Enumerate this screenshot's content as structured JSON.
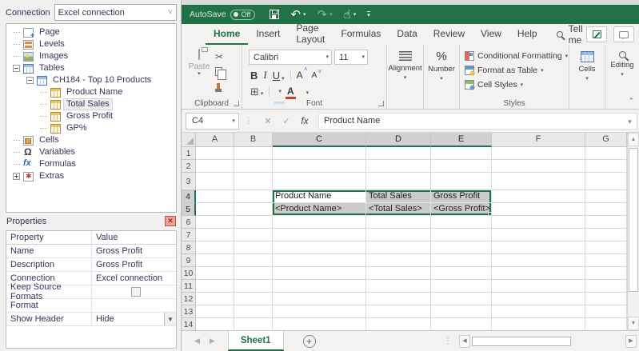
{
  "colors": {
    "excel_green": "#217346",
    "selection_fill": "#cbcbcb",
    "close_button_red": "#c0504d",
    "ribbon_bg": "#f3f2f1"
  },
  "left_panel": {
    "connection_label": "Connection",
    "connection_value": "Excel connection",
    "tree": [
      {
        "label": "Page",
        "icon": "page-icon",
        "level": 0
      },
      {
        "label": "Levels",
        "icon": "levels-icon",
        "level": 0
      },
      {
        "label": "Images",
        "icon": "images-icon",
        "level": 0
      },
      {
        "label": "Tables",
        "icon": "table-icon",
        "level": 0,
        "expander": "minus"
      },
      {
        "label": "CH184 - Top 10 Products",
        "icon": "table-icon",
        "level": 1,
        "expander": "minus"
      },
      {
        "label": "Product Name",
        "icon": "column-icon",
        "level": 2
      },
      {
        "label": "Total Sales",
        "icon": "column-icon",
        "level": 2,
        "selected": true
      },
      {
        "label": "Gross Profit",
        "icon": "column-icon",
        "level": 2
      },
      {
        "label": "GP%",
        "icon": "column-icon",
        "level": 2
      },
      {
        "label": "Cells",
        "icon": "cells-icon",
        "level": 0
      },
      {
        "label": "Variables",
        "icon": "omega-icon",
        "level": 0
      },
      {
        "label": "Formulas",
        "icon": "fx-icon",
        "level": 0
      },
      {
        "label": "Extras",
        "icon": "extras-icon",
        "level": 0,
        "expander": "plus"
      }
    ],
    "properties": {
      "title": "Properties",
      "columns": [
        "Property",
        "Value"
      ],
      "rows": [
        {
          "property": "Name",
          "value": "Gross Profit",
          "type": "text"
        },
        {
          "property": "Description",
          "value": "Gross Profit",
          "type": "text"
        },
        {
          "property": "Connection",
          "value": "Excel connection",
          "type": "text"
        },
        {
          "property": "Keep Source Formats",
          "value": "",
          "type": "checkbox",
          "checked": false
        },
        {
          "property": "Format",
          "value": "",
          "type": "text"
        },
        {
          "property": "Show Header",
          "value": "Hide",
          "type": "dropdown"
        }
      ]
    }
  },
  "excel": {
    "titlebar": {
      "autosave_label": "AutoSave",
      "autosave_state": "Off"
    },
    "tabs": [
      "Home",
      "Insert",
      "Page Layout",
      "Formulas",
      "Data",
      "Review",
      "View",
      "Help"
    ],
    "active_tab": "Home",
    "tell_me": "Tell me",
    "ribbon": {
      "paste_label": "Paste",
      "clipboard_group": "Clipboard",
      "font_name": "Calibri",
      "font_size": "11",
      "bold_label": "B",
      "italic_label": "I",
      "underline_label": "U",
      "grow_font_label": "A",
      "shrink_font_label": "A",
      "font_color_label": "A",
      "font_group": "Font",
      "alignment_group": "Alignment",
      "percent_label": "%",
      "number_group": "Number",
      "styles": [
        {
          "label": "Conditional Formatting",
          "icon": "conditional-formatting-icon"
        },
        {
          "label": "Format as Table",
          "icon": "format-as-table-icon"
        },
        {
          "label": "Cell Styles",
          "icon": "cell-styles-icon"
        }
      ],
      "styles_group": "Styles",
      "cells_group": "Cells",
      "editing_group": "Editing"
    },
    "formula_bar": {
      "name_box": "C4",
      "fx_label": "fx",
      "cancel_label": "✕",
      "enter_label": "✓",
      "content": "Product Name"
    },
    "grid": {
      "columns": [
        "A",
        "B",
        "C",
        "D",
        "E",
        "F",
        "G"
      ],
      "row_count": 14,
      "row_heights": {
        "3": 22
      },
      "cells": {
        "C4": "Product Name",
        "D4": "Total Sales",
        "E4": "Gross Profit",
        "C5": "<Product Name>",
        "D5": "<Total Sales>",
        "E5": "<Gross Profit>"
      },
      "selection": {
        "columns": [
          "C",
          "D",
          "E"
        ],
        "rows": [
          4,
          5
        ],
        "active": "C4"
      }
    },
    "sheet_bar": {
      "sheet_name": "Sheet1"
    }
  }
}
